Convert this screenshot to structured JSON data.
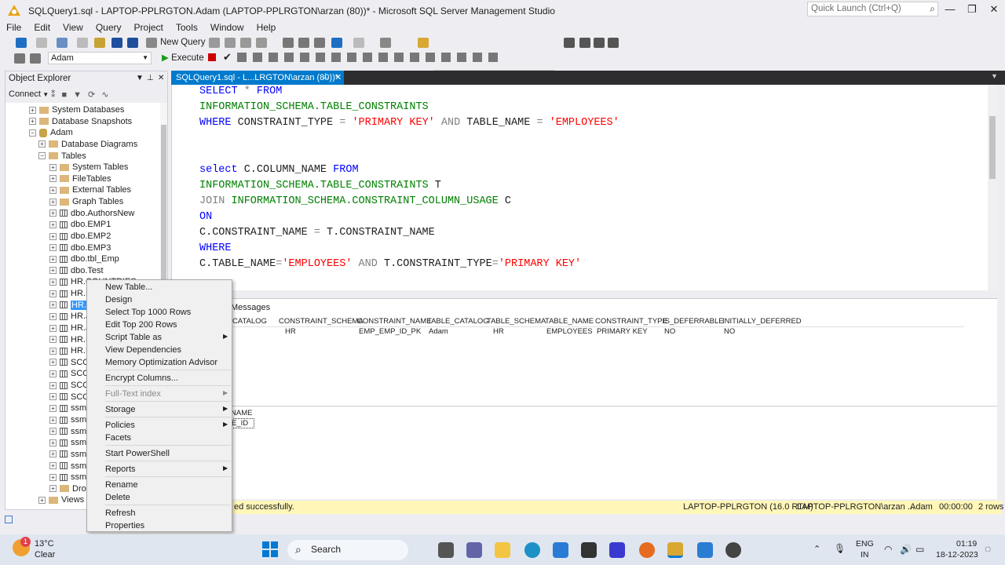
{
  "window": {
    "title": "SQLQuery1.sql - LAPTOP-PPLRGTON.Adam (LAPTOP-PPLRGTON\\arzan (80))* - Microsoft SQL Server Management Studio",
    "quick_launch_placeholder": "Quick Launch (Ctrl+Q)"
  },
  "menu": [
    "File",
    "Edit",
    "View",
    "Query",
    "Project",
    "Tools",
    "Window",
    "Help"
  ],
  "toolbar": {
    "new_query": "New Query",
    "database": "Adam",
    "execute": "Execute"
  },
  "object_explorer": {
    "title": "Object Explorer",
    "connect": "Connect",
    "nodes": [
      {
        "label": "System Databases",
        "type": "folder"
      },
      {
        "label": "Database Snapshots",
        "type": "folder"
      },
      {
        "label": "Adam",
        "type": "db"
      },
      {
        "label": "Database Diagrams",
        "type": "folder"
      },
      {
        "label": "Tables",
        "type": "folder"
      },
      {
        "label": "System Tables",
        "type": "folder"
      },
      {
        "label": "FileTables",
        "type": "folder"
      },
      {
        "label": "External Tables",
        "type": "folder"
      },
      {
        "label": "Graph Tables",
        "type": "folder"
      },
      {
        "label": "dbo.AuthorsNew",
        "type": "table"
      },
      {
        "label": "dbo.EMP1",
        "type": "table"
      },
      {
        "label": "dbo.EMP2",
        "type": "table"
      },
      {
        "label": "dbo.EMP3",
        "type": "table"
      },
      {
        "label": "dbo.tbl_Emp",
        "type": "table"
      },
      {
        "label": "dbo.Test",
        "type": "table"
      },
      {
        "label": "HR.COUNTRIES",
        "type": "table"
      },
      {
        "label": "HR.D",
        "type": "table"
      },
      {
        "label": "HR.E",
        "type": "table"
      },
      {
        "label": "HR.JO",
        "type": "table"
      },
      {
        "label": "HR.JO",
        "type": "table"
      },
      {
        "label": "HR.LO",
        "type": "table"
      },
      {
        "label": "HR.RE",
        "type": "table"
      },
      {
        "label": "SCOT",
        "type": "table"
      },
      {
        "label": "SCOT",
        "type": "table"
      },
      {
        "label": "SCOT",
        "type": "table"
      },
      {
        "label": "SCOT",
        "type": "table"
      },
      {
        "label": "ssma",
        "type": "table"
      },
      {
        "label": "ssma",
        "type": "table"
      },
      {
        "label": "ssma",
        "type": "table"
      },
      {
        "label": "ssma",
        "type": "table"
      },
      {
        "label": "ssma",
        "type": "table"
      },
      {
        "label": "ssma",
        "type": "table"
      },
      {
        "label": "ssma",
        "type": "table"
      },
      {
        "label": "Drop",
        "type": "folder"
      },
      {
        "label": "Views",
        "type": "folder"
      }
    ]
  },
  "editor_tab": "SQLQuery1.sql - L...LRGTON\\arzan (80))*",
  "code": {
    "l1a": "SELECT",
    "l1b": " * ",
    "l1c": "FROM",
    "l2": "INFORMATION_SCHEMA.TABLE_CONSTRAINTS",
    "l3a": "WHERE",
    "l3b": " CONSTRAINT_TYPE ",
    "l3c": "=",
    "l3d": " 'PRIMARY KEY' ",
    "l3e": "AND",
    "l3f": " TABLE_NAME ",
    "l3g": "=",
    "l3h": " 'EMPLOYEES'",
    "l4a": "select",
    "l4b": " C.COLUMN_NAME ",
    "l4c": "FROM",
    "l5a": "INFORMATION_SCHEMA.TABLE_CONSTRAINTS",
    "l5b": " T",
    "l6a": "JOIN",
    "l6b": " INFORMATION_SCHEMA.CONSTRAINT_COLUMN_USAGE",
    "l6c": " C",
    "l7": "ON",
    "l8a": "C.CONSTRAINT_NAME ",
    "l8b": "=",
    "l8c": " T.CONSTRAINT_NAME",
    "l9": "WHERE",
    "l10a": "C.TABLE_NAME",
    "l10b": "=",
    "l10c": "'EMPLOYEES'",
    "l10d": " AND ",
    "l10e": "T.CONSTRAINT_TYPE",
    "l10f": "=",
    "l10g": "'PRIMARY KEY'"
  },
  "results": {
    "messages_tab": "Messages",
    "headers": [
      "NT_CATALOG",
      "CONSTRAINT_SCHEMA",
      "CONSTRAINT_NAME",
      "TABLE_CATALOG",
      "TABLE_SCHEMA",
      "TABLE_NAME",
      "CONSTRAINT_TYPE",
      "IS_DEFERRABLE",
      "INITIALLY_DEFERRED"
    ],
    "row": [
      "",
      "HR",
      "EMP_EMP_ID_PK",
      "Adam",
      "HR",
      "EMPLOYEES",
      "PRIMARY KEY",
      "NO",
      "NO"
    ],
    "grid2_header": "NAME",
    "grid2_cell": "E_ID"
  },
  "status": {
    "message": "ed successfully.",
    "server": "LAPTOP-PPLRGTON (16.0 RTM)",
    "user": "LAPTOP-PPLRGTON\\arzan ...",
    "db": "Adam",
    "time": "00:00:00",
    "rows": "2 rows"
  },
  "context_menu": {
    "items": [
      {
        "label": "New Table...",
        "disabled": false,
        "submenu": false
      },
      {
        "label": "Design",
        "disabled": false,
        "submenu": false
      },
      {
        "label": "Select Top 1000 Rows",
        "disabled": false,
        "submenu": false
      },
      {
        "label": "Edit Top 200 Rows",
        "disabled": false,
        "submenu": false
      },
      {
        "label": "Script Table as",
        "disabled": false,
        "submenu": true
      },
      {
        "label": "View Dependencies",
        "disabled": false,
        "submenu": false
      },
      {
        "label": "Memory Optimization Advisor",
        "disabled": false,
        "submenu": false
      },
      {
        "label": "Encrypt Columns...",
        "disabled": false,
        "submenu": false
      },
      {
        "label": "Full-Text index",
        "disabled": true,
        "submenu": true
      },
      {
        "label": "Storage",
        "disabled": false,
        "submenu": true
      },
      {
        "label": "Policies",
        "disabled": false,
        "submenu": true
      },
      {
        "label": "Facets",
        "disabled": false,
        "submenu": false
      },
      {
        "label": "Start PowerShell",
        "disabled": false,
        "submenu": false
      },
      {
        "label": "Reports",
        "disabled": false,
        "submenu": true
      },
      {
        "label": "Rename",
        "disabled": false,
        "submenu": false
      },
      {
        "label": "Delete",
        "disabled": false,
        "submenu": false
      },
      {
        "label": "Refresh",
        "disabled": false,
        "submenu": false
      },
      {
        "label": "Properties",
        "disabled": false,
        "submenu": false
      }
    ]
  },
  "taskbar": {
    "weather_temp": "13°C",
    "weather_desc": "Clear",
    "weather_badge": "1",
    "search": "Search",
    "lang1": "ENG",
    "lang2": "IN",
    "time": "01:19",
    "date": "18-12-2023"
  }
}
